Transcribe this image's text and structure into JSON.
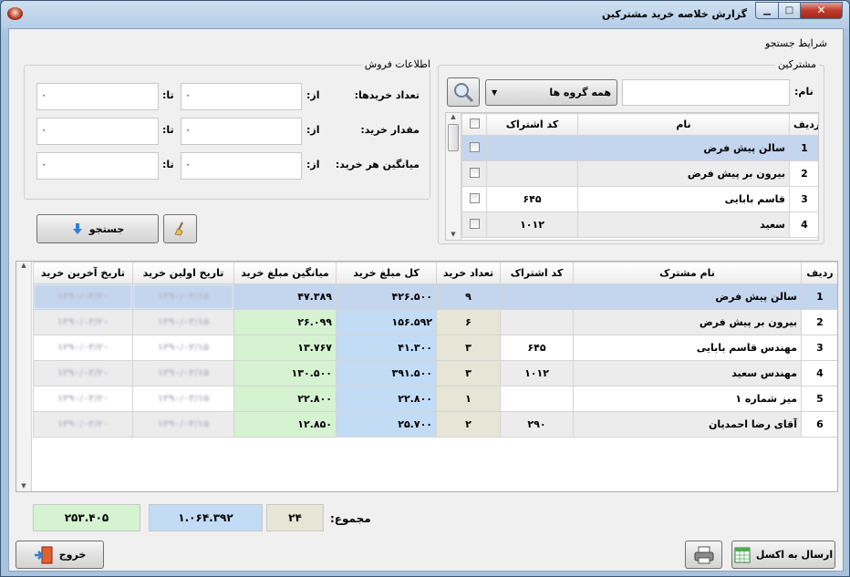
{
  "window": {
    "title": "گزارش خلاصه خرید مشترکین"
  },
  "filters": {
    "title": "شرایط جستجو",
    "subscribers": {
      "title": "مشترکین",
      "name_label": "نام:",
      "name_value": "",
      "group_value": "همه گروه ها",
      "columns": [
        "ردیف",
        "نام",
        "کد اشتراک"
      ],
      "rows": [
        {
          "num": "1",
          "name": "سالن پیش فرض",
          "code": ""
        },
        {
          "num": "2",
          "name": "بیرون بر پیش فرض",
          "code": ""
        },
        {
          "num": "3",
          "name": "قاسم بابایی",
          "code": "۶۴۵"
        },
        {
          "num": "4",
          "name": "سعید",
          "code": "۱۰۱۲"
        }
      ]
    },
    "sales": {
      "title": "اطلاعات فروش",
      "from_label": "از:",
      "to_label": "تا:",
      "rows": [
        {
          "label": "تعداد خریدها:",
          "from": "۰",
          "to": "۰"
        },
        {
          "label": "مقدار خرید:",
          "from": "۰",
          "to": "۰"
        },
        {
          "label": "میانگین هر خرید:",
          "from": "۰",
          "to": "۰"
        }
      ]
    },
    "search_label": "جستجو"
  },
  "report": {
    "columns": [
      "ردیف",
      "نام مشترک",
      "کد اشتراک",
      "تعداد خرید",
      "کل مبلغ خرید",
      "میانگین مبلغ خرید",
      "تاریخ اولین خرید",
      "تاریخ آخرین خرید"
    ],
    "rows": [
      {
        "num": "1",
        "name": "سالن پیش فرض",
        "code": "",
        "count": "۹",
        "total": "۴۲۶.۵۰۰",
        "avg": "۴۷.۳۸۹",
        "first": "۱۳۹۰/۰۳/۱۵",
        "last": "۱۳۹۰/۰۳/۲۰"
      },
      {
        "num": "2",
        "name": "بیرون بر پیش فرض",
        "code": "",
        "count": "۶",
        "total": "۱۵۶.۵۹۲",
        "avg": "۲۶.۰۹۹",
        "first": "۱۳۹۰/۰۳/۱۵",
        "last": "۱۳۹۰/۰۳/۲۰"
      },
      {
        "num": "3",
        "name": "مهندس قاسم بابایی",
        "code": "۶۴۵",
        "count": "۳",
        "total": "۴۱.۳۰۰",
        "avg": "۱۳.۷۶۷",
        "first": "۱۳۹۰/۰۳/۱۵",
        "last": "۱۳۹۰/۰۳/۲۰"
      },
      {
        "num": "4",
        "name": "مهندس سعید",
        "code": "۱۰۱۲",
        "count": "۳",
        "total": "۳۹۱.۵۰۰",
        "avg": "۱۳۰.۵۰۰",
        "first": "۱۳۹۰/۰۳/۱۵",
        "last": "۱۳۹۰/۰۳/۲۰"
      },
      {
        "num": "5",
        "name": "میز شماره ۱",
        "code": "",
        "count": "۱",
        "total": "۲۲.۸۰۰",
        "avg": "۲۲.۸۰۰",
        "first": "۱۳۹۰/۰۳/۱۵",
        "last": "۱۳۹۰/۰۳/۲۰"
      },
      {
        "num": "6",
        "name": "آقای رضا احمدیان",
        "code": "۲۹۰",
        "count": "۲",
        "total": "۲۵.۷۰۰",
        "avg": "۱۲.۸۵۰",
        "first": "۱۳۹۰/۰۳/۱۵",
        "last": "۱۳۹۰/۰۳/۲۰"
      }
    ]
  },
  "totals": {
    "label": "مجموع:",
    "count": "۲۴",
    "total": "۱.۰۶۴.۳۹۲",
    "avg": "۲۵۳.۴۰۵"
  },
  "actions": {
    "exit": "خروج",
    "excel": "ارسال به اکسل"
  }
}
